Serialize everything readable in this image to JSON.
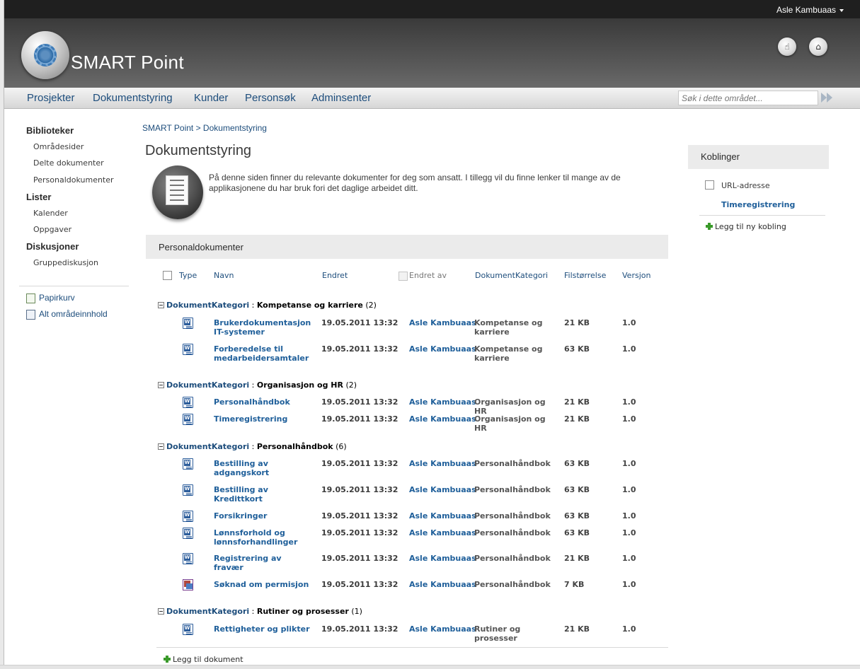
{
  "user": {
    "name": "Asle Kambuaas"
  },
  "brand": {
    "name": "SMART Point"
  },
  "header_icons": [
    "like-icon",
    "tag-icon"
  ],
  "topnav": [
    "Prosjekter",
    "Dokumentstyring",
    "Kunder",
    "Personsøk",
    "Adminsenter"
  ],
  "search": {
    "placeholder": "Søk i dette området..."
  },
  "leftnav": {
    "sections": [
      {
        "title": "Biblioteker",
        "items": [
          "Områdesider",
          "Delte dokumenter",
          "Personaldokumenter"
        ]
      },
      {
        "title": "Lister",
        "items": [
          "Kalender",
          "Oppgaver"
        ]
      },
      {
        "title": "Diskusjoner",
        "items": [
          "Gruppediskusjon"
        ]
      }
    ],
    "tools": [
      "Papirkurv",
      "Alt områdeinnhold"
    ]
  },
  "breadcrumb": "SMART Point > Dokumentstyring",
  "page_title": "Dokumentstyring",
  "intro": "På denne siden finner du relevante dokumenter for deg som ansatt. I tillegg vil du finne lenker til mange av de applikasjonene du har bruk fori det daglige arbeidet ditt.",
  "webpart": {
    "title": "Personaldokumenter",
    "columns": [
      "Type",
      "Navn",
      "Endret",
      "Endret av",
      "DokumentKategori",
      "Filstørrelse",
      "Versjon"
    ],
    "group_field": "DokumentKategori",
    "groups": [
      {
        "name": "Kompetanse og karriere",
        "count": "(2)",
        "rows": [
          {
            "type": "word",
            "name": "Brukerdokumentasjon IT-systemer",
            "modified": "19.05.2011 13:32",
            "by": "Asle Kambuaas",
            "category": "Kompetanse og karriere",
            "size": "21 KB",
            "version": "1.0"
          },
          {
            "type": "word",
            "name": "Forberedelse til medarbeidersamtaler",
            "modified": "19.05.2011 13:32",
            "by": "Asle Kambuaas",
            "category": "Kompetanse og karriere",
            "size": "63 KB",
            "version": "1.0"
          }
        ]
      },
      {
        "name": "Organisasjon og HR",
        "count": "(2)",
        "rows": [
          {
            "type": "word",
            "name": "Personalhåndbok",
            "modified": "19.05.2011 13:32",
            "by": "Asle Kambuaas",
            "category": "Organisasjon og HR",
            "size": "21 KB",
            "version": "1.0"
          },
          {
            "type": "word",
            "name": "Timeregistrering",
            "modified": "19.05.2011 13:32",
            "by": "Asle Kambuaas",
            "category": "Organisasjon og HR",
            "size": "21 KB",
            "version": "1.0"
          }
        ]
      },
      {
        "name": "Personalhåndbok",
        "count": "(6)",
        "rows": [
          {
            "type": "word",
            "name": "Bestilling av adgangskort",
            "modified": "19.05.2011 13:32",
            "by": "Asle Kambuaas",
            "category": "Personalhåndbok",
            "size": "63 KB",
            "version": "1.0"
          },
          {
            "type": "word",
            "name": "Bestilling av Kredittkort",
            "modified": "19.05.2011 13:32",
            "by": "Asle Kambuaas",
            "category": "Personalhåndbok",
            "size": "63 KB",
            "version": "1.0"
          },
          {
            "type": "word",
            "name": "Forsikringer",
            "modified": "19.05.2011 13:32",
            "by": "Asle Kambuaas",
            "category": "Personalhåndbok",
            "size": "63 KB",
            "version": "1.0"
          },
          {
            "type": "word",
            "name": "Lønnsforhold og lønnsforhandlinger",
            "modified": "19.05.2011 13:32",
            "by": "Asle Kambuaas",
            "category": "Personalhåndbok",
            "size": "63 KB",
            "version": "1.0"
          },
          {
            "type": "word",
            "name": "Registrering av fravær",
            "modified": "19.05.2011 13:32",
            "by": "Asle Kambuaas",
            "category": "Personalhåndbok",
            "size": "21 KB",
            "version": "1.0"
          },
          {
            "type": "form",
            "name": "Søknad om permisjon",
            "modified": "19.05.2011 13:32",
            "by": "Asle Kambuaas",
            "category": "Personalhåndbok",
            "size": "7 KB",
            "version": "1.0"
          }
        ]
      },
      {
        "name": "Rutiner og prosesser",
        "count": "(1)",
        "rows": [
          {
            "type": "word",
            "name": "Rettigheter og plikter",
            "modified": "19.05.2011 13:32",
            "by": "Asle Kambuaas",
            "category": "Rutiner og prosesser",
            "size": "21 KB",
            "version": "1.0"
          }
        ]
      }
    ],
    "add_label": "Legg til dokument"
  },
  "links": {
    "title": "Koblinger",
    "column": "URL-adresse",
    "items": [
      "Timeregistrering"
    ],
    "add_label": "Legg til ny kobling"
  },
  "colors": {
    "link": "#1f5f9a",
    "nav": "#1d4d7c",
    "header_dark": "#1f1f1f",
    "panel_gray": "#ebebeb"
  }
}
